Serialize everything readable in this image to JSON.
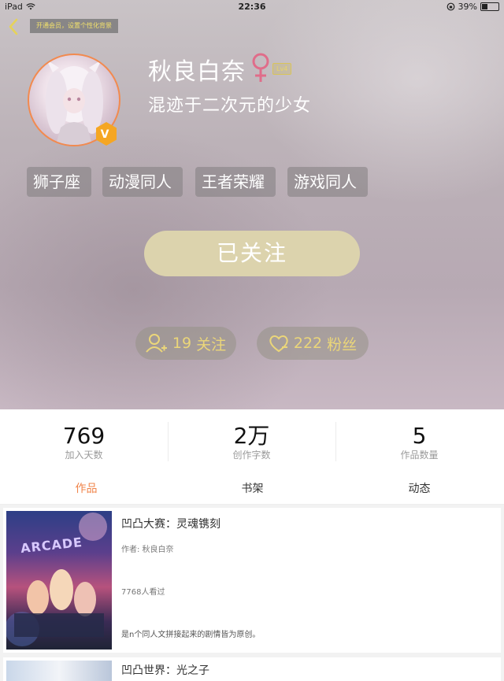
{
  "status_bar": {
    "device": "iPad",
    "time": "22:36",
    "battery": "39%",
    "battery_level": 0.39
  },
  "header": {
    "vip_banner": "开通会员，设置个性化背景"
  },
  "profile": {
    "nickname": "秋良白奈",
    "gender_symbol": "♀",
    "level": "Lv4",
    "bio": "混迹于二次元的少女",
    "vip_badge": "V",
    "tags": [
      "狮子座",
      "动漫同人",
      "王者荣耀",
      "游戏同人"
    ],
    "follow_button": "已关注",
    "following": {
      "count": "19",
      "label": "关注"
    },
    "fans": {
      "count": "222",
      "label": "粉丝"
    }
  },
  "stats": [
    {
      "value": "769",
      "label": "加入天数"
    },
    {
      "value": "2万",
      "label": "创作字数"
    },
    {
      "value": "5",
      "label": "作品数量"
    }
  ],
  "tabs": [
    {
      "label": "作品",
      "active": true
    },
    {
      "label": "书架",
      "active": false
    },
    {
      "label": "动态",
      "active": false
    }
  ],
  "works": [
    {
      "title": "凹凸大赛：灵魂镌刻",
      "author": "作者: 秋良白奈",
      "views": "7768人看过",
      "description": "是n个同人文拼接起来的剧情皆为原创。",
      "cover_text": "ARCADE"
    },
    {
      "title": "凹凸世界：光之子"
    }
  ],
  "colors": {
    "accent": "#f0844a",
    "follow_button_bg": "#dcd3ad",
    "pill_text": "#ebd679",
    "gender": "#e06d8a"
  }
}
